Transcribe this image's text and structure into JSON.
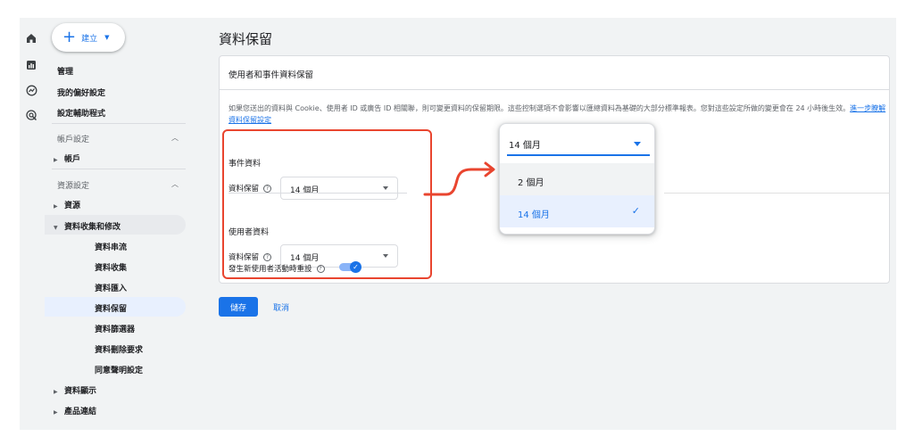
{
  "create_button": {
    "label": "建立"
  },
  "nav": {
    "admin": "管理",
    "preferences": "我的偏好設定",
    "setup_assistant": "設定輔助程式",
    "account_settings": "帳戶設定",
    "account": "帳戶",
    "property_settings": "資源設定",
    "property": "資源",
    "data_collection_modification": "資料收集和修改",
    "data_streams": "資料串流",
    "data_collection": "資料收集",
    "data_import": "資料匯入",
    "data_retention": "資料保留",
    "data_filters": "資料篩選器",
    "data_deletion_requests": "資料刪除要求",
    "consent_settings": "同意聲明設定",
    "data_display": "資料顯示",
    "product_links": "產品連結"
  },
  "main": {
    "title": "資料保留",
    "card_title": "使用者和事件資料保留",
    "description": "如果您送出的資料與 Cookie、使用者 ID 或廣告 ID 相關聯，則可變更資料的保留期限。這些控制選項不會影響以匯總資料為基礎的大部分標準報表。您對這些設定所做的變更會在 24 小時後生效。",
    "learn_more": "進一步瞭解資料保留設定",
    "event_data": {
      "heading": "事件資料",
      "field_label": "資料保留",
      "value": "14 個月"
    },
    "user_data": {
      "heading": "使用者資料",
      "field_label": "資料保留",
      "value": "14 個月"
    },
    "reset_toggle": {
      "label": "發生新使用者活動時重設",
      "enabled": true
    },
    "save_label": "儲存",
    "cancel_label": "取消"
  },
  "dropdown_popup": {
    "selected": "14 個月",
    "options": [
      "2 個月",
      "14 個月"
    ]
  },
  "colors": {
    "accent": "#1a73e8",
    "highlight": "#e9452f"
  }
}
